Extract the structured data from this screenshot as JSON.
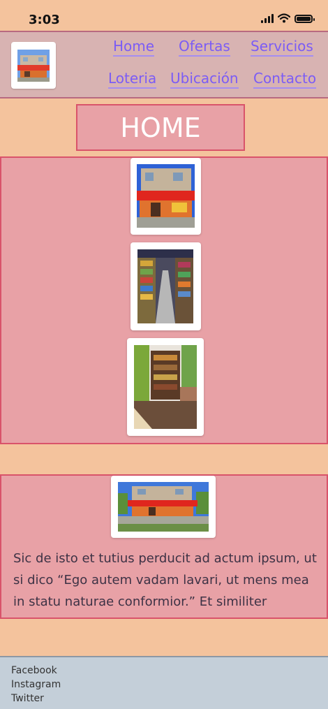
{
  "status_bar": {
    "time": "3:03"
  },
  "header": {
    "nav": [
      {
        "label": "Home"
      },
      {
        "label": "Ofertas"
      },
      {
        "label": "Servicios"
      },
      {
        "label": "Loteria"
      },
      {
        "label": "Ubicación"
      },
      {
        "label": "Contacto"
      }
    ]
  },
  "page": {
    "title": "HOME"
  },
  "info": {
    "text": "Sic de isto et tutius perducit ad actum ipsum, ut si dico “Ego autem vadam lavari, ut mens mea in statu naturae conformior.” Et similiter"
  },
  "footer": {
    "links": [
      {
        "label": "Facebook"
      },
      {
        "label": "Instagram"
      },
      {
        "label": "Twitter"
      }
    ]
  }
}
